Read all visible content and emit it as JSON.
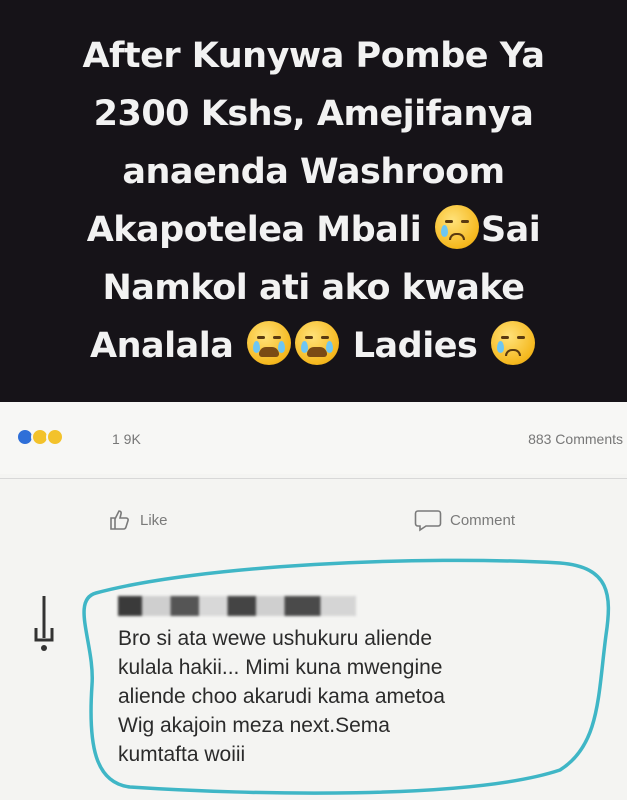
{
  "post": {
    "text_lines": [
      "After Kunywa Pombe Ya",
      "2300 Kshs,  Amejifanya",
      "anaenda Washroom",
      "Akapotelea Mbali",
      "Sai",
      "Namkol ati ako kwake",
      "Analala",
      "Ladies"
    ]
  },
  "reactions": {
    "count": "1 9K",
    "comments": "883 Comments",
    "icons": [
      "like-icon",
      "haha-icon",
      "sad-icon"
    ]
  },
  "actions": {
    "like_label": "Like",
    "comment_label": "Comment"
  },
  "comment": {
    "lines": [
      "Bro si ata wewe ushukuru aliende",
      "kulala hakii... Mimi kuna mwengine",
      "aliende choo akarudi kama ametoa",
      "Wig akajoin meza next.Sema",
      "kumtafta woiii"
    ]
  },
  "colors": {
    "post_background": "#161318",
    "annotation_circle": "#3fb6c6",
    "like_blue": "#2f6fd8"
  }
}
